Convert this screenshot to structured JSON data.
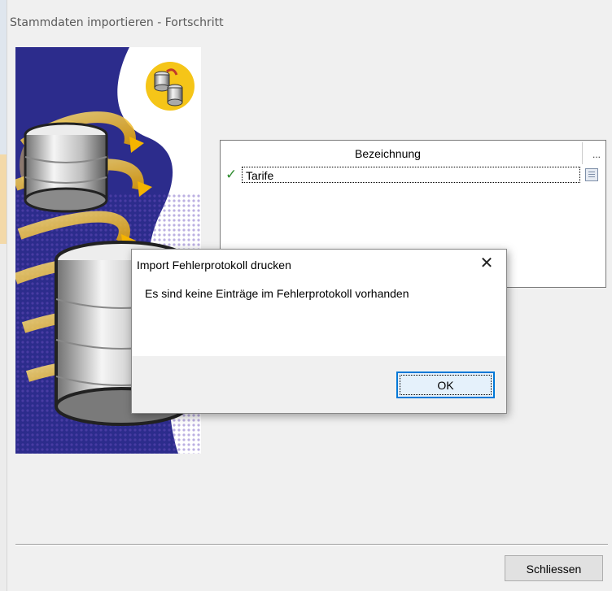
{
  "window": {
    "title": "Stammdaten importieren - Fortschritt"
  },
  "list": {
    "column_header": "Bezeichnung",
    "more_indicator": "...",
    "rows": [
      {
        "status_icon": "check-icon",
        "label": "Tarife",
        "action_icon": "document-icon"
      }
    ]
  },
  "footer": {
    "close_label": "Schliessen"
  },
  "dialog": {
    "title": "Import Fehlerprotokoll drucken",
    "close_glyph": "✕",
    "message": "Es sind keine Einträge im Fehlerprotokoll vorhanden",
    "ok_label": "OK"
  },
  "colors": {
    "wizard_blue": "#2c2c8c",
    "accent_yellow": "#f5c518",
    "dialog_button_focus": "#0078d7",
    "check_green": "#2e8b2e"
  }
}
